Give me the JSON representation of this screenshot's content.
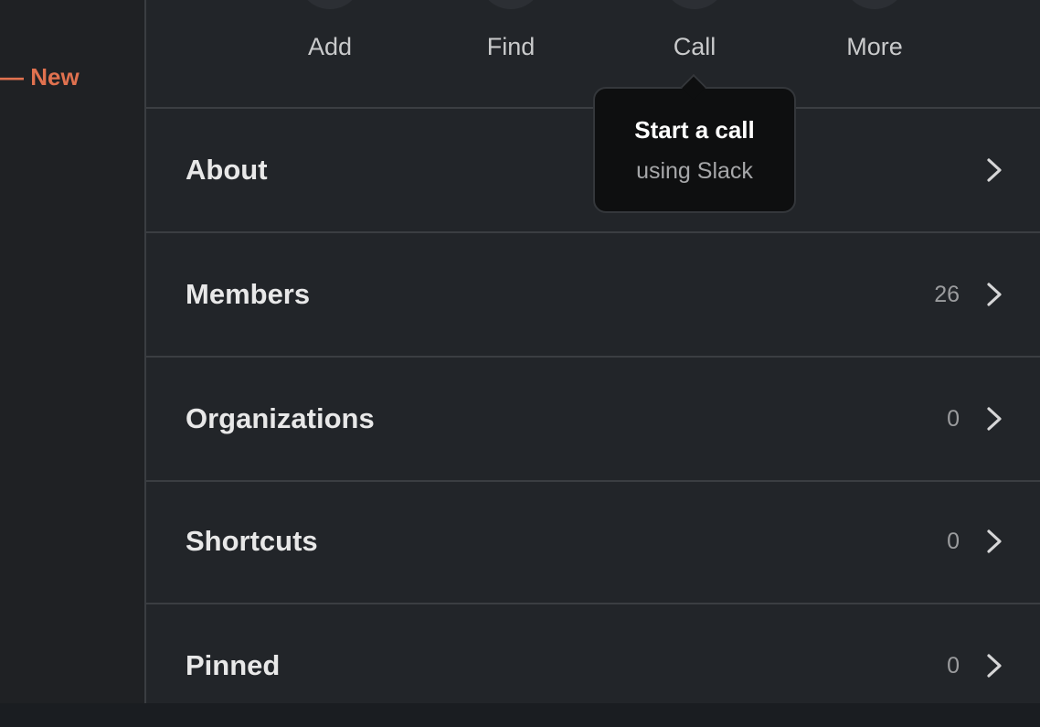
{
  "sidebar": {
    "new_divider_label": "— New"
  },
  "channel_actions": [
    {
      "label": "Add",
      "icon": "add-icon"
    },
    {
      "label": "Find",
      "icon": "search-icon"
    },
    {
      "label": "Call",
      "icon": "phone-icon"
    },
    {
      "label": "More",
      "icon": "more-icon"
    }
  ],
  "tooltip": {
    "title": "Start a call",
    "subtitle": "using Slack"
  },
  "details_rows": [
    {
      "label": "About",
      "count": ""
    },
    {
      "label": "Members",
      "count": "26"
    },
    {
      "label": "Organizations",
      "count": "0"
    },
    {
      "label": "Shortcuts",
      "count": "0"
    },
    {
      "label": "Pinned",
      "count": "0"
    }
  ],
  "colors": {
    "background": "#222529",
    "rail": "#1f2124",
    "accent_new": "#e0714f",
    "tooltip_bg": "#0e0f10",
    "divider": "#3b3e42",
    "text": "#e8e8e8"
  }
}
